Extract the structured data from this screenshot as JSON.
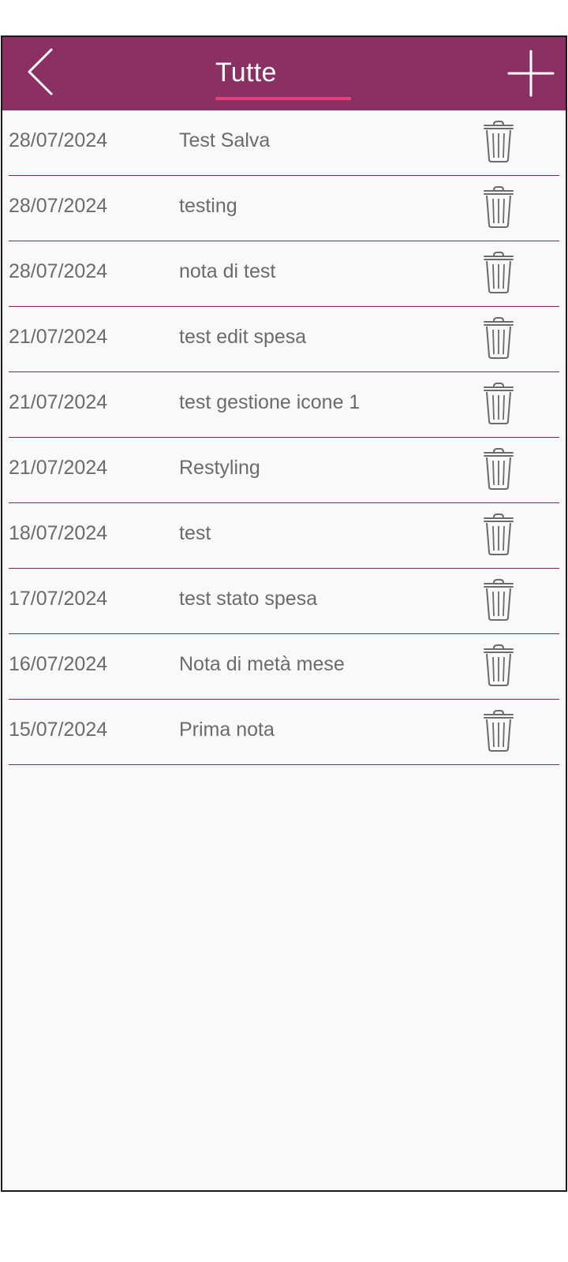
{
  "header": {
    "back_icon": "chevron-left-icon",
    "add_icon": "plus-icon",
    "tab_label": "Tutte"
  },
  "colors": {
    "header_bg": "#8b3062",
    "tab_underline": "#e83e7c",
    "divider": "#7a2a55",
    "text": "#6b6b6b",
    "list_bg": "#f9f9f9"
  },
  "notes": [
    {
      "date": "28/07/2024",
      "title": "Test Salva",
      "action_icon": "trash-icon"
    },
    {
      "date": "28/07/2024",
      "title": "testing",
      "action_icon": "trash-icon"
    },
    {
      "date": "28/07/2024",
      "title": "nota di test",
      "action_icon": "trash-icon"
    },
    {
      "date": "21/07/2024",
      "title": "test edit spesa",
      "action_icon": "trash-icon"
    },
    {
      "date": "21/07/2024",
      "title": "test gestione icone 1",
      "action_icon": "trash-icon"
    },
    {
      "date": "21/07/2024",
      "title": "Restyling",
      "action_icon": "trash-icon"
    },
    {
      "date": "18/07/2024",
      "title": "test",
      "action_icon": "trash-icon"
    },
    {
      "date": "17/07/2024",
      "title": "test stato spesa",
      "action_icon": "trash-icon"
    },
    {
      "date": "16/07/2024",
      "title": "Nota di metà mese",
      "action_icon": "trash-icon"
    },
    {
      "date": "15/07/2024",
      "title": "Prima nota",
      "action_icon": "trash-icon"
    }
  ]
}
